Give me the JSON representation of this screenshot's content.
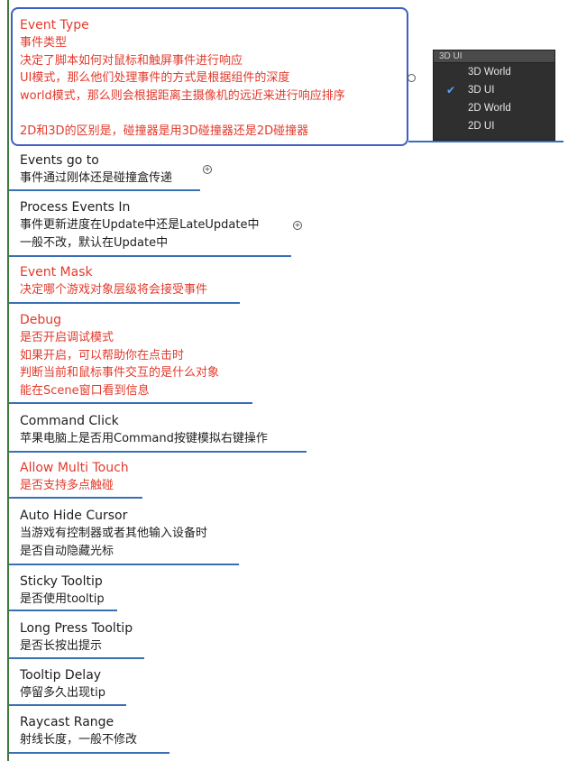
{
  "nodes": [
    {
      "id": "event-type",
      "title": "Event Type",
      "color": "red",
      "lines": [
        "事件类型",
        "决定了脚本如何对鼠标和触屏事件进行响应",
        "UI模式，那么他们处理事件的方式是根据组件的深度",
        "world模式，那么则会根据距离主摄像机的远近来进行响应排序",
        "",
        "2D和3D的区别是，碰撞器是用3D碰撞器还是2D碰撞器"
      ],
      "line_color": "red"
    },
    {
      "id": "events-go-to",
      "title": "Events go to",
      "color": "dark",
      "lines": [
        "事件通过刚体还是碰撞盒传递"
      ],
      "line_color": "dark"
    },
    {
      "id": "process-events-in",
      "title": "Process Events In",
      "color": "dark",
      "lines": [
        "事件更新进度在Update中还是LateUpdate中",
        "一般不改，默认在Update中"
      ],
      "line_color": "dark"
    },
    {
      "id": "event-mask",
      "title": "Event Mask",
      "color": "red",
      "lines": [
        "决定哪个游戏对象层级将会接受事件"
      ],
      "line_color": "red"
    },
    {
      "id": "debug",
      "title": "Debug",
      "color": "red",
      "lines": [
        "是否开启调试模式",
        "如果开启，可以帮助你在点击时",
        "判断当前和鼠标事件交互的是什么对象",
        "能在Scene窗口看到信息"
      ],
      "line_color": "red"
    },
    {
      "id": "command-click",
      "title": "Command Click",
      "color": "dark",
      "lines": [
        "苹果电脑上是否用Command按键模拟右键操作"
      ],
      "line_color": "dark"
    },
    {
      "id": "allow-multi-touch",
      "title": "Allow Multi Touch",
      "color": "red",
      "lines": [
        "是否支持多点触碰"
      ],
      "line_color": "red"
    },
    {
      "id": "auto-hide-cursor",
      "title": "Auto Hide Cursor",
      "color": "dark",
      "lines": [
        "当游戏有控制器或者其他输入设备时",
        "是否自动隐藏光标"
      ],
      "line_color": "dark"
    },
    {
      "id": "sticky-tooltip",
      "title": "Sticky Tooltip",
      "color": "dark",
      "lines": [
        "是否使用tooltip"
      ],
      "line_color": "dark"
    },
    {
      "id": "long-press-tooltip",
      "title": "Long Press Tooltip",
      "color": "dark",
      "lines": [
        "是否长按出提示"
      ],
      "line_color": "dark"
    },
    {
      "id": "tooltip-delay",
      "title": "Tooltip Delay",
      "color": "dark",
      "lines": [
        "停留多久出现tip"
      ],
      "line_color": "dark"
    },
    {
      "id": "raycast-range",
      "title": "Raycast Range",
      "color": "dark",
      "lines": [
        "射线长度，一般不修改"
      ],
      "line_color": "dark"
    }
  ],
  "dropdown": {
    "header": "3D UI",
    "items": [
      {
        "label": "3D World",
        "checked": false
      },
      {
        "label": "3D UI",
        "checked": true
      },
      {
        "label": "2D World",
        "checked": false
      },
      {
        "label": "2D UI",
        "checked": false
      }
    ]
  },
  "colors": {
    "red": "#e23a2c",
    "dark": "#1e1e1e",
    "branch": "#3e7a3e",
    "underline": "#3a6fb5",
    "selection": "#3c5fc4"
  }
}
